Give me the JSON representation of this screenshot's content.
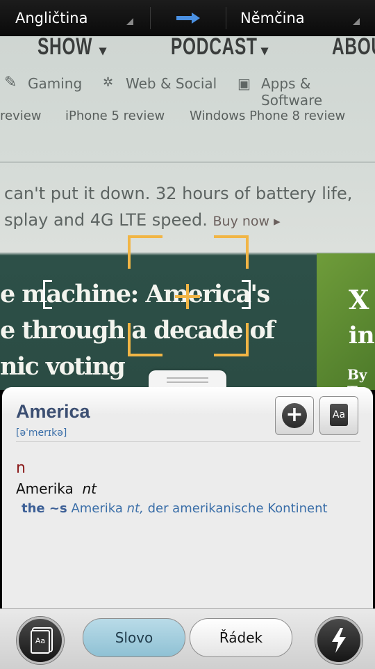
{
  "topbar": {
    "source_language": "Angličtina",
    "target_language": "Němčina",
    "arrow_color": "#4a90e2"
  },
  "camera_view": {
    "nav": [
      "SHOW",
      "PODCAST",
      "ABOU"
    ],
    "categories": [
      "Gaming",
      "Web & Social",
      "Apps & Software"
    ],
    "reviews": [
      "review",
      "iPhone 5 review",
      "Windows Phone 8 review"
    ],
    "ad_line1": "can't put it down. 32 hours of battery life,",
    "ad_line2": "splay and 4G LTE speed.",
    "buy_now": "Buy now ▸",
    "headline": [
      "e machine: America's",
      "e through a decade of",
      "nic voting"
    ],
    "side_headline": [
      "X",
      "in",
      "By T"
    ],
    "focus_color": "#f1b545"
  },
  "dictionary": {
    "word": "America",
    "phonetic": "[əˈmerɪkə]",
    "part_of_speech": "n",
    "translation": "Amerika",
    "translation_gender": "nt",
    "example_phrase": "the ~s",
    "example_translation": "Amerika",
    "example_gender": "nt,",
    "example_rest": "der amerikanische Kontinent",
    "add_icon": "plus-circle-icon",
    "dictionary_icon": "book-icon",
    "book_glyph": "Aa"
  },
  "bottombar": {
    "word_mode": "Slovo",
    "line_mode": "Řádek",
    "cards_glyph": "Aa",
    "active_mode": "Slovo",
    "left_icon": "flashcards-icon",
    "right_icon": "flash-icon"
  }
}
